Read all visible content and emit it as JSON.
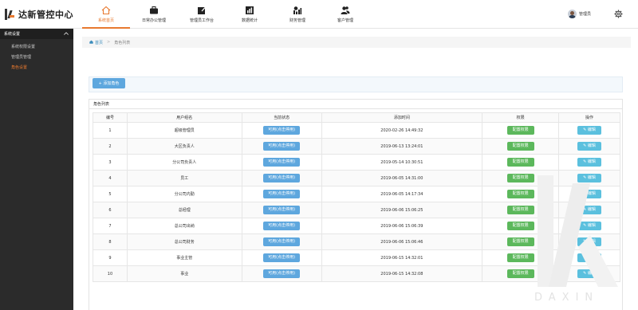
{
  "app": {
    "title": "达新管控中心"
  },
  "nav": [
    {
      "label": "系统首页",
      "icon": "home-icon",
      "active": true
    },
    {
      "label": "日常办公管理",
      "icon": "briefcase-icon",
      "active": false
    },
    {
      "label": "管理员工作台",
      "icon": "edit-icon",
      "active": false
    },
    {
      "label": "数据统计",
      "icon": "bar-chart-icon",
      "active": false
    },
    {
      "label": "财务管理",
      "icon": "finance-icon",
      "active": false
    },
    {
      "label": "客户管理",
      "icon": "users-icon",
      "active": false
    }
  ],
  "user": {
    "name": "管理员"
  },
  "sidebar": {
    "section": "系统设置",
    "items": [
      {
        "label": "系统权限设置",
        "active": false
      },
      {
        "label": "管理员管理",
        "active": false
      },
      {
        "label": "角色设置",
        "active": true
      }
    ]
  },
  "breadcrumb": {
    "home": "首页",
    "separator": ">",
    "current": "角色列表"
  },
  "toolbar": {
    "add_label": "+ 添加角色"
  },
  "panel": {
    "title": "角色列表"
  },
  "table": {
    "columns": [
      "编号",
      "用户组名",
      "当前状态",
      "添加时间",
      "权限",
      "操作"
    ],
    "status_label": "可用(点击停用)",
    "perm_label": "配置权限",
    "edit_label": "编辑",
    "rows": [
      {
        "id": "1",
        "name": "超级管理员",
        "time": "2020-02-26 14:49:32"
      },
      {
        "id": "2",
        "name": "大区负责人",
        "time": "2019-06-13 13:24:01"
      },
      {
        "id": "3",
        "name": "分公司负责人",
        "time": "2019-05-14 10:30:51"
      },
      {
        "id": "4",
        "name": "员工",
        "time": "2019-06-05 14:31:00"
      },
      {
        "id": "5",
        "name": "分公司内勤",
        "time": "2019-06-05 14:17:34"
      },
      {
        "id": "6",
        "name": "总经理",
        "time": "2019-06-06 15:06:25"
      },
      {
        "id": "7",
        "name": "总公司出纳",
        "time": "2019-06-06 15:06:39"
      },
      {
        "id": "8",
        "name": "总公司财务",
        "time": "2019-06-06 15:06:46"
      },
      {
        "id": "9",
        "name": "事业主管",
        "time": "2019-06-15 14:32:01"
      },
      {
        "id": "10",
        "name": "事业",
        "time": "2019-06-15 14:32:08"
      }
    ]
  },
  "watermark": {
    "text": "DAXIN"
  },
  "colors": {
    "accent": "#e8792f",
    "primary": "#5ea7de",
    "success": "#5cb85c",
    "info": "#5bc0de",
    "sidebar": "#2b2b2b"
  }
}
